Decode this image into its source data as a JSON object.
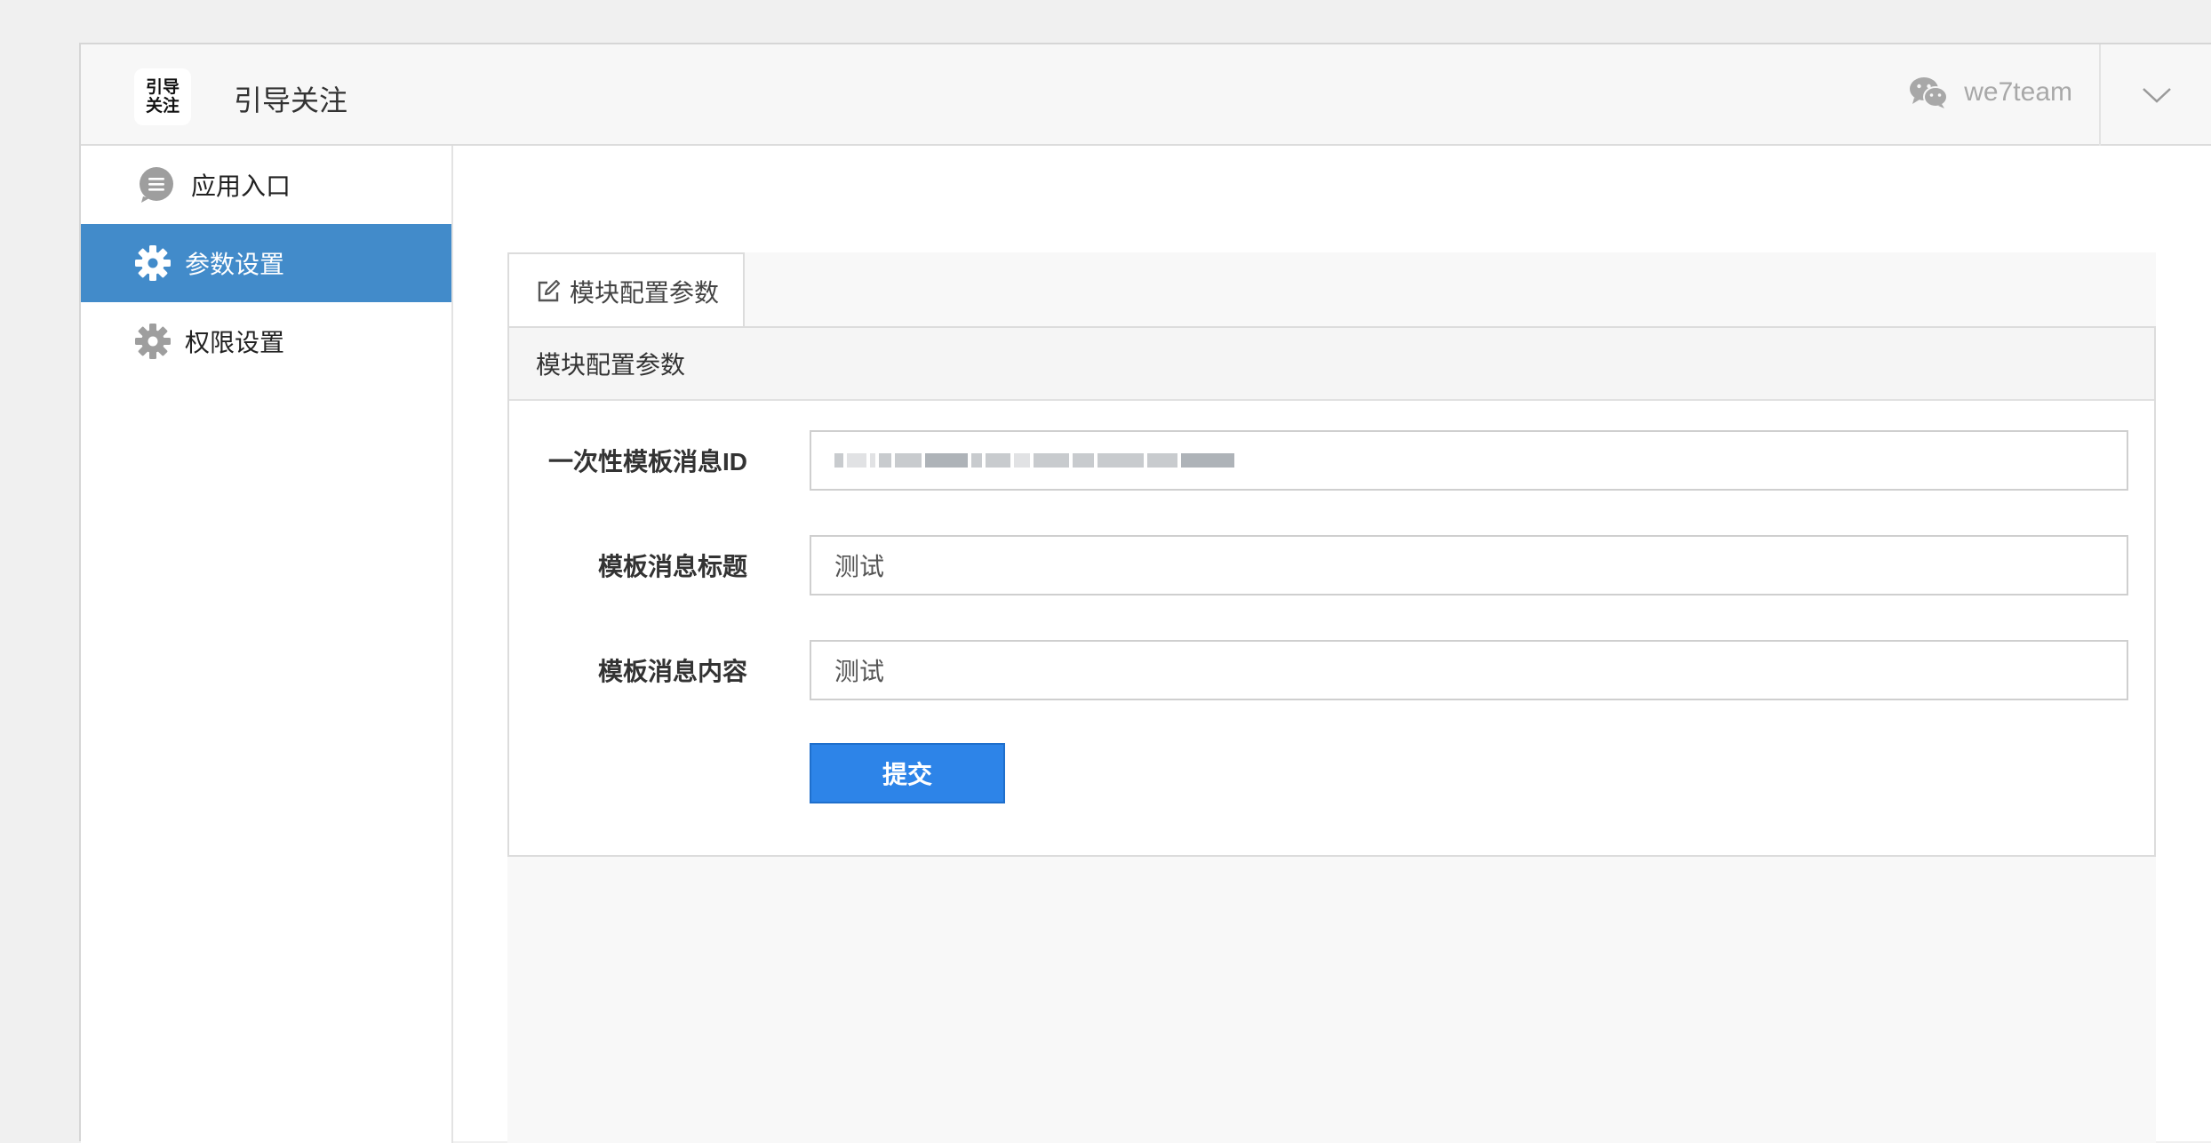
{
  "header": {
    "logo_text_line1": "引导",
    "logo_text_line2": "关注",
    "app_title": "引导关注",
    "account_name": "we7team"
  },
  "sidebar": {
    "items": [
      {
        "label": "应用入口",
        "icon": "chat-bubble-icon",
        "active": false
      },
      {
        "label": "参数设置",
        "icon": "gear-icon",
        "active": true
      },
      {
        "label": "权限设置",
        "icon": "gear-icon",
        "active": false
      }
    ]
  },
  "main": {
    "tab_label": "模块配置参数",
    "card_heading": "模块配置参数",
    "fields": [
      {
        "label": "一次性模板消息ID",
        "value": ""
      },
      {
        "label": "模板消息标题",
        "value": "测试"
      },
      {
        "label": "模板消息内容",
        "value": "测试"
      }
    ],
    "submit_label": "提交"
  },
  "colors": {
    "active_nav_bg": "#428bca",
    "submit_bg": "#2d84e8"
  }
}
